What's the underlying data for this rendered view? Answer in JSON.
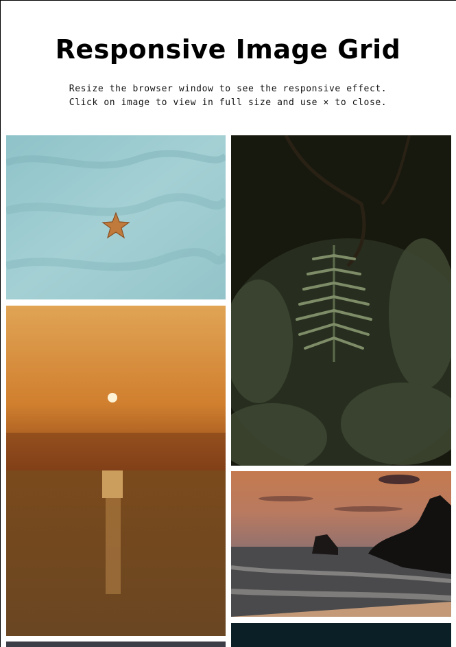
{
  "header": {
    "title": "Responsive Image Grid",
    "subtitle_line1": "Resize the browser window to see the responsive effect.",
    "subtitle_line2": "Click on image to view in full size and use × to close."
  },
  "gallery": {
    "images": [
      {
        "subject": "starfish on sand"
      },
      {
        "subject": "fern leaves in dark forest"
      },
      {
        "subject": "sunset over the ocean"
      },
      {
        "subject": "rocky coastline at dusk"
      },
      {
        "subject": "partial image (cropped)"
      },
      {
        "subject": "partial image (cropped)"
      }
    ]
  }
}
